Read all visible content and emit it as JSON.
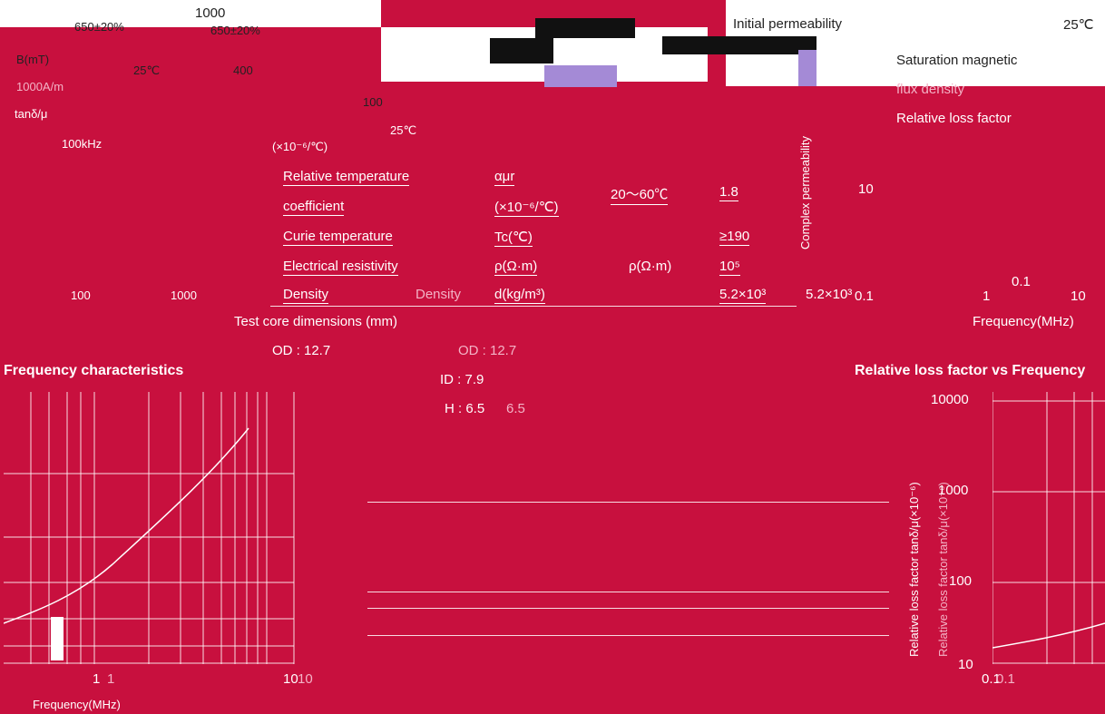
{
  "colors": {
    "background": "#c8103e",
    "panel": "#ffffff",
    "accent_lavender": "#a48ad6"
  },
  "top_left": {
    "value_pm1": "650±20%",
    "value_pm2": "650±20%",
    "bm_label": "B(mT)",
    "temp_a": "25℃",
    "val_400": "400",
    "field": "1000A/m",
    "tan_label": "tanδ/μ",
    "freq_100k": "100kHz"
  },
  "top_scale": {
    "v1000": "1000",
    "v100": "100"
  },
  "left_axis": {
    "v100": "100",
    "v1000": "1000",
    "temp": "25℃"
  },
  "properties": {
    "header_tc": "(×10⁻⁶/℃)",
    "rel_temp": "Relative temperature",
    "coefficient": "coefficient",
    "alpha": "αμr",
    "coef_unit": "(×10⁻⁶/℃)",
    "range": "20～60℃",
    "range_val": "1.8",
    "curie": "Curie temperature",
    "tc": "Tc(℃)",
    "tc_val": "≥190",
    "resistivity": "Electrical resistivity",
    "rho": "ρ(Ω·m)",
    "rho2": "ρ(Ω·m)",
    "rho_val": "10⁵",
    "density": "Density",
    "density2": "Density",
    "d_unit": "d(kg/m³)",
    "d_val": "5.2×10³",
    "d_val2": "5.2×10³"
  },
  "right_top": {
    "initial_perm": "Initial permeability",
    "initial_temp": "25℃",
    "saturation": "Saturation magnetic",
    "flux": "flux density",
    "rel_loss": "Relative loss factor",
    "v10": "10"
  },
  "right_axis": {
    "v01": "0.1",
    "v1": "1",
    "v10": "10",
    "vfirst": "0.1",
    "freq": "Frequency(MHz)"
  },
  "complex_label": "Complex permeability",
  "core": {
    "title": "Test core dimensions (mm)",
    "od": "OD : 12.7",
    "od2": "OD : 12.7",
    "id": "ID : 7.9",
    "h": "H : 6.5",
    "h2": "6.5"
  },
  "left_chart": {
    "title": "Frequency characteristics",
    "x1": "1",
    "x1b": "1",
    "x10": "10",
    "x10b": "10",
    "xlabel": "Frequency(MHz)"
  },
  "right_chart": {
    "title": "Relative loss factor vs Frequency",
    "ylabel": "Relative loss factor tanδ/μ(×10⁻⁶)",
    "ylabel2": "Relative loss factor tanδ/μ(×10⁻⁶)",
    "y10000": "10000",
    "y1000": "1000",
    "y100": "100",
    "y10": "10",
    "x01": "0.1",
    "x01b": "0.1"
  }
}
